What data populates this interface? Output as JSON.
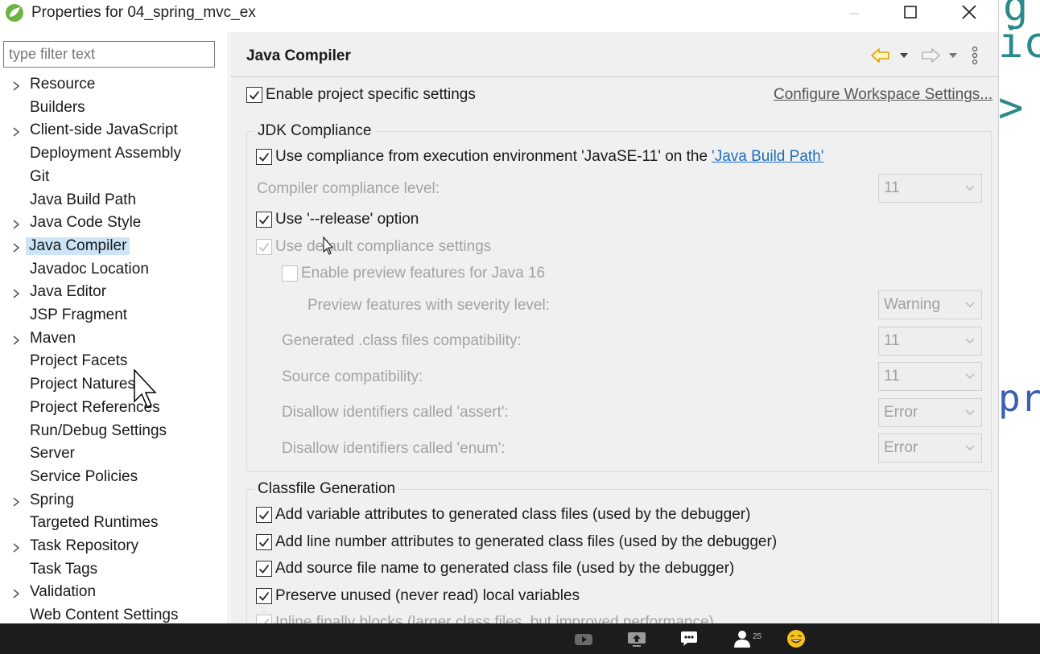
{
  "window": {
    "title": "Properties for 04_spring_mvc_ex"
  },
  "filter": {
    "placeholder": "type filter text"
  },
  "tree": [
    {
      "label": "Resource",
      "expandable": true
    },
    {
      "label": "Builders",
      "expandable": false
    },
    {
      "label": "Client-side JavaScript",
      "expandable": true
    },
    {
      "label": "Deployment Assembly",
      "expandable": false
    },
    {
      "label": "Git",
      "expandable": false
    },
    {
      "label": "Java Build Path",
      "expandable": false
    },
    {
      "label": "Java Code Style",
      "expandable": true
    },
    {
      "label": "Java Compiler",
      "expandable": true,
      "selected": true
    },
    {
      "label": "Javadoc Location",
      "expandable": false
    },
    {
      "label": "Java Editor",
      "expandable": true
    },
    {
      "label": "JSP Fragment",
      "expandable": false
    },
    {
      "label": "Maven",
      "expandable": true
    },
    {
      "label": "Project Facets",
      "expandable": false
    },
    {
      "label": "Project Natures",
      "expandable": false
    },
    {
      "label": "Project References",
      "expandable": false
    },
    {
      "label": "Run/Debug Settings",
      "expandable": false
    },
    {
      "label": "Server",
      "expandable": false
    },
    {
      "label": "Service Policies",
      "expandable": false
    },
    {
      "label": "Spring",
      "expandable": true
    },
    {
      "label": "Targeted Runtimes",
      "expandable": false
    },
    {
      "label": "Task Repository",
      "expandable": true
    },
    {
      "label": "Task Tags",
      "expandable": false
    },
    {
      "label": "Validation",
      "expandable": true
    },
    {
      "label": "Web Content Settings",
      "expandable": false
    }
  ],
  "page": {
    "title": "Java Compiler",
    "enable_project_specific": "Enable project specific settings",
    "configure_workspace": "Configure Workspace Settings..."
  },
  "jdk": {
    "group_title": "JDK Compliance",
    "use_compliance_prefix": "Use compliance from execution environment 'JavaSE-11' on the ",
    "use_compliance_link": "'Java Build Path'",
    "compiler_level_label": "Compiler compliance level:",
    "compiler_level_value": "11",
    "use_release": "Use '--release' option",
    "use_default": "Use default compliance settings",
    "enable_preview": "Enable preview features for Java 16",
    "preview_severity_label": "Preview features with severity level:",
    "preview_severity_value": "Warning",
    "generated_compat_label": "Generated .class files compatibility:",
    "generated_compat_value": "11",
    "source_compat_label": "Source compatibility:",
    "source_compat_value": "11",
    "disallow_assert_label": "Disallow identifiers called 'assert':",
    "disallow_assert_value": "Error",
    "disallow_enum_label": "Disallow identifiers called 'enum':",
    "disallow_enum_value": "Error"
  },
  "classfile": {
    "group_title": "Classfile Generation",
    "opt1": "Add variable attributes to generated class files (used by the debugger)",
    "opt2": "Add line number attributes to generated class files (used by the debugger)",
    "opt3": "Add source file name to generated class file (used by the debugger)",
    "opt4": "Preserve unused (never read) local variables",
    "opt5": "Inline finally blocks (larger class files, but improved performance)"
  },
  "taskbar": {
    "participant_count": "25"
  },
  "colors": {
    "selection": "#cce4f7",
    "link": "#1a6fc0",
    "panel": "#f0f0f0"
  }
}
